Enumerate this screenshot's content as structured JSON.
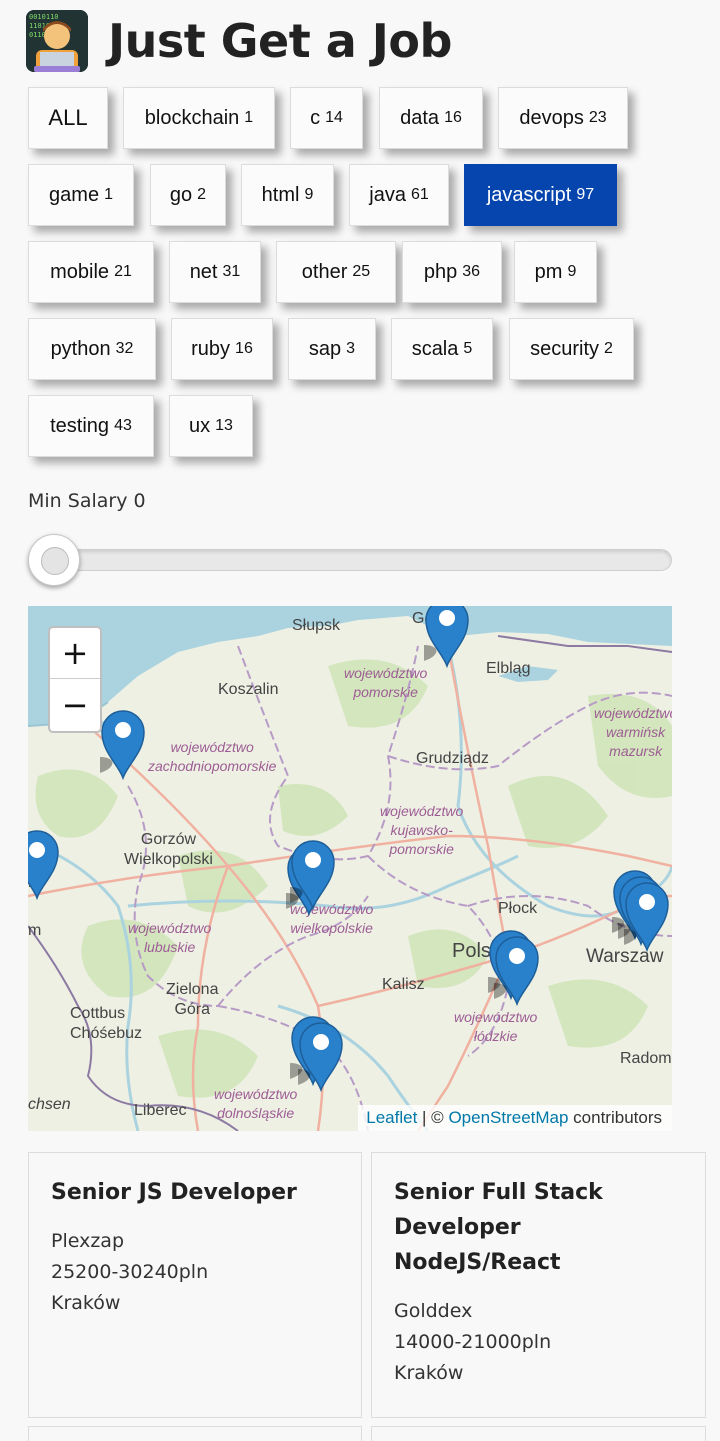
{
  "header": {
    "title": "Just Get a Job",
    "logo_icon": "developer-emoji-icon"
  },
  "tags": [
    {
      "name": "ALL",
      "count": ""
    },
    {
      "name": "blockchain",
      "count": "1"
    },
    {
      "name": "c",
      "count": "14"
    },
    {
      "name": "data",
      "count": "16"
    },
    {
      "name": "devops",
      "count": "23"
    },
    {
      "name": "game",
      "count": "1"
    },
    {
      "name": "go",
      "count": "2"
    },
    {
      "name": "html",
      "count": "9"
    },
    {
      "name": "java",
      "count": "61"
    },
    {
      "name": "javascript",
      "count": "97",
      "active": true
    },
    {
      "name": "mobile",
      "count": "21"
    },
    {
      "name": "net",
      "count": "31"
    },
    {
      "name": "other",
      "count": "25"
    },
    {
      "name": "php",
      "count": "36"
    },
    {
      "name": "pm",
      "count": "9"
    },
    {
      "name": "python",
      "count": "32"
    },
    {
      "name": "ruby",
      "count": "16"
    },
    {
      "name": "sap",
      "count": "3"
    },
    {
      "name": "scala",
      "count": "5"
    },
    {
      "name": "security",
      "count": "2"
    },
    {
      "name": "testing",
      "count": "43"
    },
    {
      "name": "ux",
      "count": "13"
    }
  ],
  "filter": {
    "label": "Min Salary 0",
    "value": 0
  },
  "map": {
    "zoom_in": "+",
    "zoom_out": "−",
    "cities": [
      "Słupsk",
      "Koszalin",
      "Elbląg",
      "Grudziądz",
      "Gorzów\nWielkopolski",
      "Płock",
      "Warszaw",
      "Kalisz",
      "Zielona\nGóra",
      "Cottbus\nChóśebuz",
      "Liberec",
      "Radom",
      "chsen",
      "Gd",
      "Pols",
      "m",
      "in"
    ],
    "regions": [
      "województwo\npomorskie",
      "województwo\nzachodniopomorskie",
      "województwo\nkujawsko-\npomorskie",
      "województwo\nwarmińsk\nmazursk",
      "województwo\nwielkopolskie",
      "województwo\nlubuskie",
      "województwo\nłódzkie",
      "województwo\ndolnośląskie"
    ],
    "attribution": {
      "leaflet": "Leaflet",
      "sep": " | © ",
      "osm": "OpenStreetMap",
      "rest": " contributors"
    },
    "marker_color": "#2a81cb"
  },
  "jobs": [
    {
      "title": "Senior JS Developer",
      "company": "Plexzap",
      "salary": "25200-30240pln",
      "city": "Kraków"
    },
    {
      "title": "Senior Full Stack Developer NodeJS/React",
      "company": "Golddex",
      "salary": "14000-21000pln",
      "city": "Kraków"
    }
  ],
  "colors": {
    "active_tag": "#0645ad",
    "water": "#aad3df",
    "land": "#eef0e4",
    "link": "#0078a8"
  }
}
